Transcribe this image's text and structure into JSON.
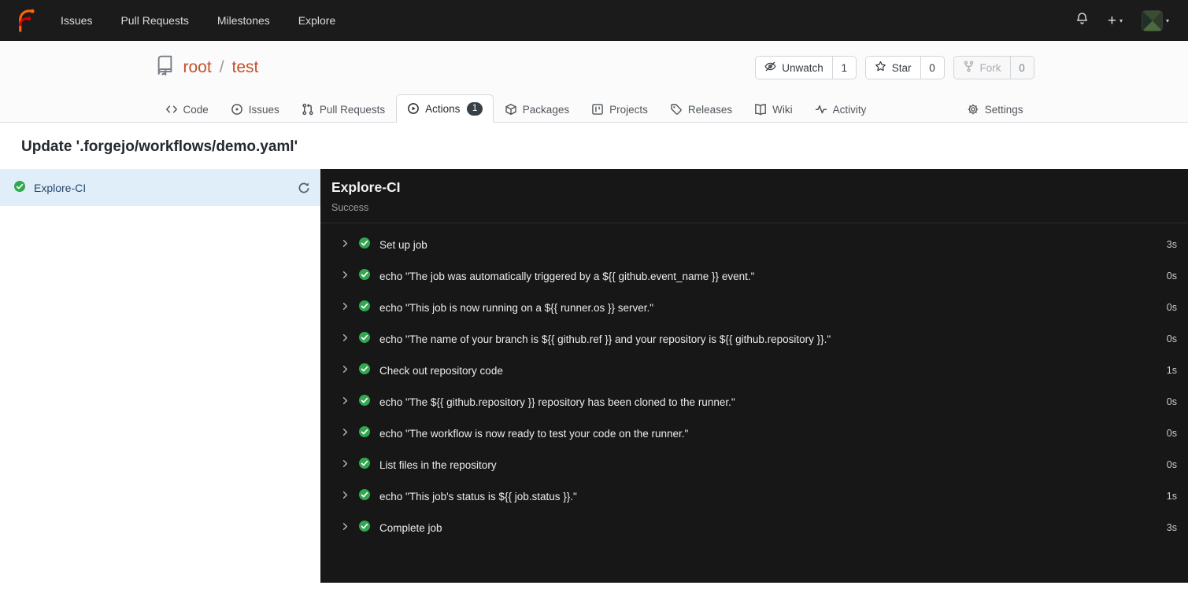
{
  "navbar": {
    "items": [
      "Issues",
      "Pull Requests",
      "Milestones",
      "Explore"
    ]
  },
  "repo_header": {
    "owner": "root",
    "separator": "/",
    "name": "test",
    "buttons": {
      "unwatch": {
        "label": "Unwatch",
        "count": "1"
      },
      "star": {
        "label": "Star",
        "count": "0"
      },
      "fork": {
        "label": "Fork",
        "count": "0"
      }
    }
  },
  "tabs": {
    "items": [
      {
        "label": "Code"
      },
      {
        "label": "Issues"
      },
      {
        "label": "Pull Requests"
      },
      {
        "label": "Actions",
        "badge": "1"
      },
      {
        "label": "Packages"
      },
      {
        "label": "Projects"
      },
      {
        "label": "Releases"
      },
      {
        "label": "Wiki"
      },
      {
        "label": "Activity"
      },
      {
        "label": "Settings"
      }
    ]
  },
  "run": {
    "title": "Update '.forgejo/workflows/demo.yaml'",
    "job_list": [
      {
        "name": "Explore-CI"
      }
    ],
    "panel": {
      "title": "Explore-CI",
      "status": "Success",
      "steps": [
        {
          "label": "Set up job",
          "duration": "3s"
        },
        {
          "label": "echo \"The job was automatically triggered by a ${{ github.event_name }} event.\"",
          "duration": "0s"
        },
        {
          "label": "echo \"This job is now running on a ${{ runner.os }} server.\"",
          "duration": "0s"
        },
        {
          "label": "echo \"The name of your branch is ${{ github.ref }} and your repository is ${{ github.repository }}.\"",
          "duration": "0s"
        },
        {
          "label": "Check out repository code",
          "duration": "1s"
        },
        {
          "label": "echo \"The ${{ github.repository }} repository has been cloned to the runner.\"",
          "duration": "0s"
        },
        {
          "label": "echo \"The workflow is now ready to test your code on the runner.\"",
          "duration": "0s"
        },
        {
          "label": "List files in the repository",
          "duration": "0s"
        },
        {
          "label": "echo \"This job's status is ${{ job.status }}.\"",
          "duration": "1s"
        },
        {
          "label": "Complete job",
          "duration": "3s"
        }
      ]
    }
  },
  "icons": {
    "logo": "forgejo-logo",
    "notifications": "bell-icon",
    "create_new": "plus-icon",
    "user_menu": "avatar",
    "repo": "repo-icon",
    "unwatch": "eye-slash-icon",
    "star": "star-icon",
    "fork": "git-fork-icon",
    "code": "code-icon",
    "issues": "issue-opened-icon",
    "pull_requests": "git-pull-request-icon",
    "actions": "play-circle-icon",
    "packages": "package-icon",
    "projects": "project-board-icon",
    "releases": "tag-icon",
    "wiki": "book-icon",
    "activity": "pulse-icon",
    "settings": "gear-icon",
    "job_success": "check-circle-icon",
    "rerun": "sync-icon",
    "expand": "chevron-right-icon"
  },
  "colors": {
    "navbar_bg": "#1b1b1b",
    "accent_orange": "#ff6600",
    "accent_red": "#d40000",
    "repo_link": "#c4502c",
    "success_green": "#2fa84f",
    "panel_bg": "#171717",
    "active_job_bg": "#e0eef9"
  }
}
